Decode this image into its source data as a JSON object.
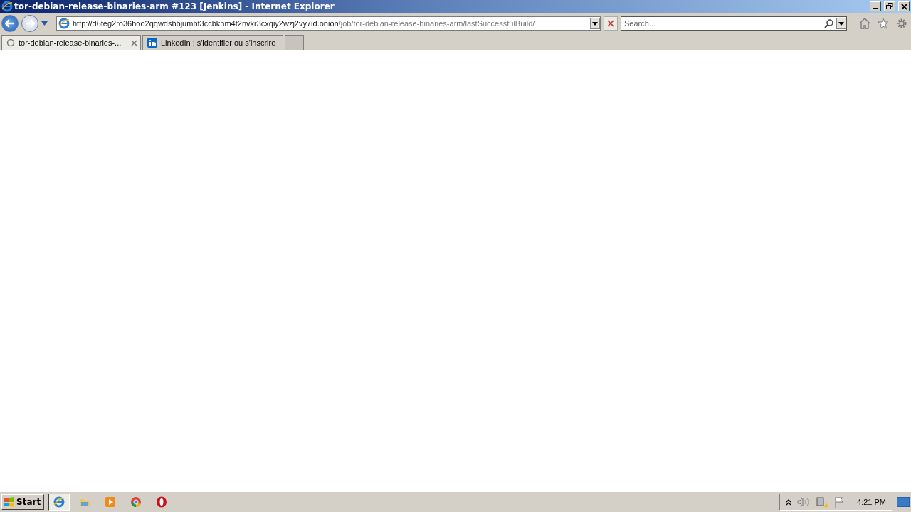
{
  "window": {
    "title": "tor-debian-release-binaries-arm #123 [Jenkins] - Internet Explorer"
  },
  "address": {
    "host": "http://d6feg2ro36hoo2qqwdshbjumhf3ccbknm4t2nvkr3cxqiy2wzj2vy7id.onion",
    "path": "/job/tor-debian-release-binaries-arm/lastSuccessfulBuild/"
  },
  "search": {
    "placeholder": "Search..."
  },
  "tabs": [
    {
      "label": "tor-debian-release-binaries-...",
      "selected": true,
      "kind": "loading"
    },
    {
      "label": "LinkedIn : s'identifier ou s'inscrire",
      "selected": false,
      "kind": "linkedin"
    }
  ],
  "taskbar": {
    "start": "Start",
    "apps": [
      {
        "kind": "ie",
        "selected": true
      },
      {
        "kind": "folder",
        "selected": false
      },
      {
        "kind": "media",
        "selected": false
      },
      {
        "kind": "chrome",
        "selected": false
      },
      {
        "kind": "opera",
        "selected": false
      }
    ],
    "clock": "4:21 PM"
  }
}
